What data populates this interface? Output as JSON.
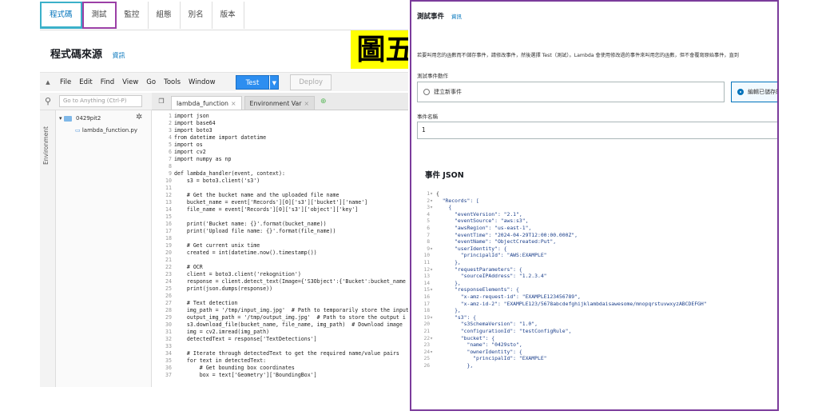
{
  "figure_label": "圖五",
  "tabs": [
    "程式碼",
    "測試",
    "監控",
    "組態",
    "別名",
    "版本"
  ],
  "code_source": {
    "title": "程式碼來源",
    "info": "資訊"
  },
  "menu": [
    "File",
    "Edit",
    "Find",
    "View",
    "Go",
    "Tools",
    "Window"
  ],
  "buttons": {
    "test": "Test",
    "deploy": "Deploy"
  },
  "search": {
    "placeholder": "Go to Anything (Ctrl-P)"
  },
  "editor_tabs": [
    "lambda_function",
    "Environment Var"
  ],
  "environment_label": "Environment",
  "file_tree": {
    "folder": "0429pit2",
    "file": "lambda_function.py"
  },
  "code": [
    "import json",
    "import base64",
    "import boto3",
    "from datetime import datetime",
    "import os",
    "import cv2",
    "import numpy as np",
    "",
    "def lambda_handler(event, context):",
    "    s3 = boto3.client('s3')",
    "",
    "    # Get the bucket name and the uploaded file name",
    "    bucket_name = event['Records'][0]['s3']['bucket']['name']",
    "    file_name = event['Records'][0]['s3']['object']['key']",
    "",
    "    print('Bucket name: {}'.format(bucket_name))",
    "    print('Upload file name: {}'.format(file_name))",
    "",
    "    # Get current unix time",
    "    created = int(datetime.now().timestamp())",
    "",
    "    # OCR",
    "    client = boto3.client('rekognition')",
    "    response = client.detect_text(Image={'S3Object':{'Bucket':bucket_name",
    "    print(json.dumps(response))",
    "",
    "    # Text detection",
    "    img_path = '/tmp/input_img.jpg'  # Path to temporarily store the input",
    "    output_img_path = '/tmp/output_img.jpg'  # Path to store the output i",
    "    s3.download_file(bucket_name, file_name, img_path)  # Download image",
    "    img = cv2.imread(img_path)",
    "    detectedText = response['TextDetections']",
    "",
    "    # Iterate through detectedText to get the required name/value pairs",
    "    for text in detectedText:",
    "        # Get bounding box coordinates",
    "        box = text['Geometry']['BoundingBox']"
  ],
  "test_event": {
    "title": "測試事件",
    "info": "資訊",
    "description": "若要叫用您的函數而不儲存事件，請修改事件，然後選擇 Test（測試）。Lambda 會使用修改過的事件來叫用您的函數，但不會覆寫原始事件，直到",
    "action_label": "測試事件動作",
    "option_new": "建立新事件",
    "option_edit": "編輯已儲存的",
    "name_label": "事件名稱",
    "name_value": "1",
    "json_title": "事件 JSON"
  },
  "json_lines": [
    "{",
    "  \"Records\": [",
    "    {",
    "      \"eventVersion\": \"2.1\",",
    "      \"eventSource\": \"aws:s3\",",
    "      \"awsRegion\": \"us-east-1\",",
    "      \"eventTime\": \"2024-04-29T12:00:00.000Z\",",
    "      \"eventName\": \"ObjectCreated:Put\",",
    "      \"userIdentity\": {",
    "        \"principalId\": \"AWS:EXAMPLE\"",
    "      },",
    "      \"requestParameters\": {",
    "        \"sourceIPAddress\": \"1.2.3.4\"",
    "      },",
    "      \"responseElements\": {",
    "        \"x-amz-request-id\": \"EXAMPLE123456789\",",
    "        \"x-amz-id-2\": \"EXAMPLE123/5678abcdefghijklambdaisawesome/mnopqrstuvwxyzABCDEFGH\"",
    "      },",
    "      \"s3\": {",
    "        \"s3SchemaVersion\": \"1.0\",",
    "        \"configurationId\": \"testConfigRule\",",
    "        \"bucket\": {",
    "          \"name\": \"0429sto\",",
    "          \"ownerIdentity\": {",
    "            \"principalId\": \"EXAMPLE\"",
    "          },"
  ]
}
